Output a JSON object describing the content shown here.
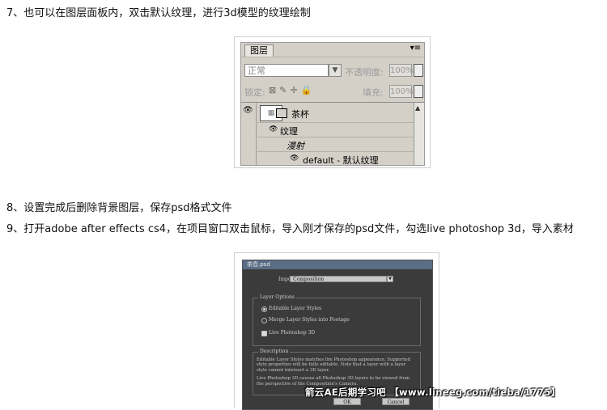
{
  "steps": {
    "s7": "7、也可以在图层面板内，双击默认纹理，进行3d模型的纹理绘制",
    "s8": "8、设置完成后删除背景图层，保存psd格式文件",
    "s9": "9、打开adobe after effects cs4，在项目窗口双击鼠标，导入刚才保存的psd文件，勾选live photoshop 3d，导入素材"
  },
  "layers_panel": {
    "tab": "图层",
    "menu_icon": "panel-menu-icon",
    "blend_mode": "正常",
    "opacity_label": "不透明度:",
    "opacity_value": "100%",
    "lock_label": "锁定:",
    "fill_label": "填充:",
    "fill_value": "100%",
    "layers": [
      {
        "name": "茶杯"
      },
      {
        "name": "纹理"
      },
      {
        "name": "漫射"
      },
      {
        "name": "default - 默认纹理"
      }
    ]
  },
  "import_dialog": {
    "title": "茶壶.psd",
    "import_kind_label": "Import Kind",
    "import_kind_value": "Composition",
    "layer_options_label": "Layer Options",
    "option_editable": "Editable Layer Styles",
    "option_merge": "Merge Layer Styles into Footage",
    "option_live3d": "Live Photoshop 3D",
    "description_label": "Description",
    "description_p1": "Editable Layer Styles matches the Photoshop appearance. Supported style properties will be fully editable. Note that a layer with a layer style cannot intersect a 3D layer.",
    "description_p2": "Live Photoshop 3D causes all Photoshop 3D layers to be viewed from the perspective of the Composition's Camera.",
    "ok_label": "OK",
    "cancel_label": "Cancel"
  },
  "watermark": "箭云AE后期学习吧 【www.lineeg.com/tieba/1775】"
}
